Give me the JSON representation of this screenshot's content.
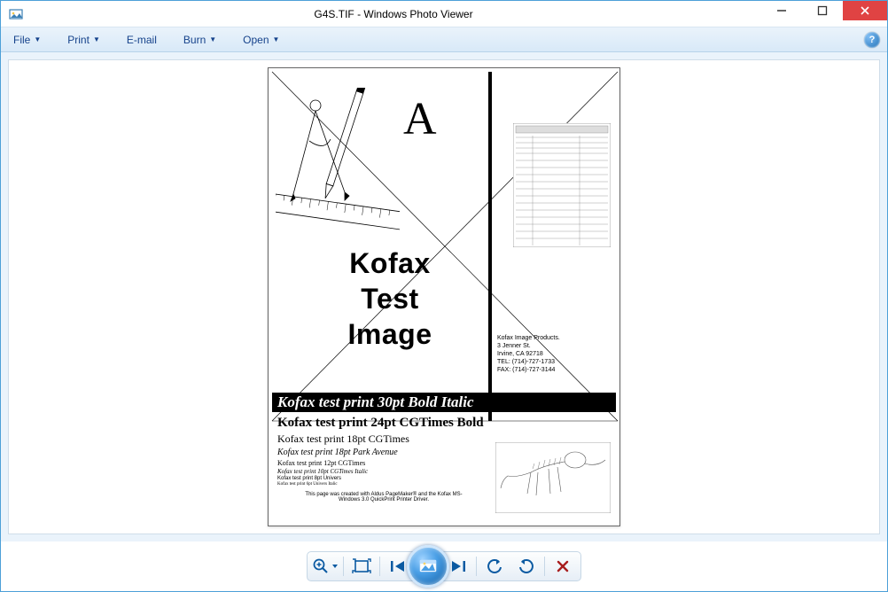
{
  "window": {
    "title": "G4S.TIF - Windows Photo Viewer"
  },
  "menu": {
    "file": "File",
    "print": "Print",
    "email": "E-mail",
    "burn": "Burn",
    "open": "Open"
  },
  "page": {
    "big_letter": "A",
    "heading1": "Kofax",
    "heading2": "Test",
    "heading3": "Image",
    "address": {
      "l1": "Kofax Image Products.",
      "l2": "3 Jenner St.",
      "l3": "Irvine, CA 92718",
      "l4": "TEL:    (714)-727-1733",
      "l5": "FAX:   (714)-727-3144"
    },
    "strip": "Kofax test print 30pt Bold Italic",
    "lines": {
      "l1": "Kofax test print 24pt CGTimes Bold",
      "l2": "Kofax test print 18pt CGTimes",
      "l3": "Kofax test print 18pt Park Avenue",
      "l4": "Kofax test print 12pt CGTimes",
      "l5": "Kofax test print 10pt CGTimes Italic",
      "l6": "Kofax test print 8pt Univers",
      "l7": "Kofax test print 6pt Univers Italic"
    },
    "footer": "This page was created with Aldus PageMaker® and the Kofax MS-Windows 3.0 QuickPrint Printer Driver."
  },
  "toolbar": {
    "zoom_label": "Change the display size",
    "fit_label": "Actual size",
    "prev_label": "Previous",
    "slideshow_label": "Play slide show",
    "next_label": "Next",
    "ccw_label": "Rotate counterclockwise",
    "cw_label": "Rotate clockwise",
    "delete_label": "Delete"
  },
  "help_tooltip": "Get help"
}
